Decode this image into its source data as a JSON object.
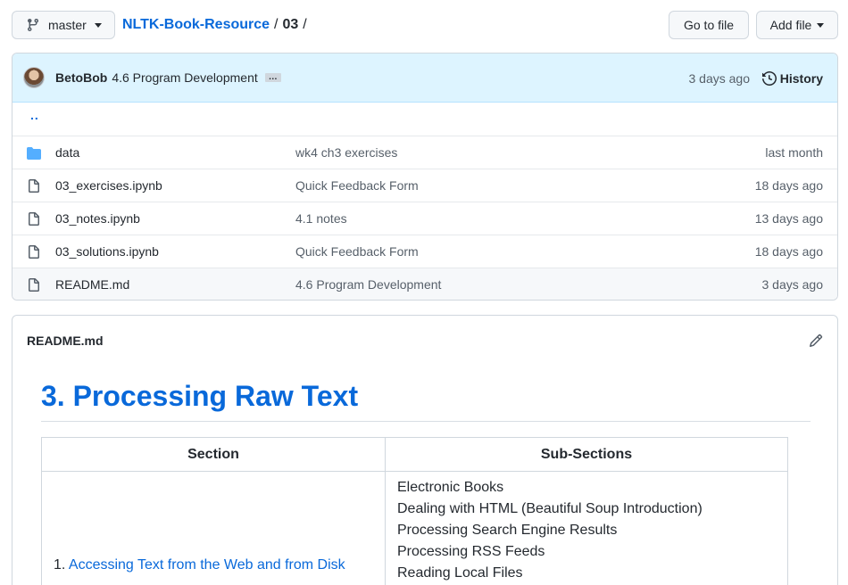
{
  "header": {
    "branch": "master",
    "repo": "NLTK-Book-Resource",
    "sep1": "/",
    "folder": "03",
    "sep2": "/",
    "go_to_file": "Go to file",
    "add_file": "Add file"
  },
  "commit": {
    "author": "BetoBob",
    "message": "4.6 Program Development",
    "ellipsis": "…",
    "age": "3 days ago",
    "history": "History"
  },
  "files": {
    "parent": "..",
    "rows": [
      {
        "name": "data",
        "type": "folder",
        "message": "wk4 ch3 exercises",
        "age": "last month"
      },
      {
        "name": "03_exercises.ipynb",
        "type": "file",
        "message": "Quick Feedback Form",
        "age": "18 days ago"
      },
      {
        "name": "03_notes.ipynb",
        "type": "file",
        "message": "4.1 notes",
        "age": "13 days ago"
      },
      {
        "name": "03_solutions.ipynb",
        "type": "file",
        "message": "Quick Feedback Form",
        "age": "18 days ago"
      },
      {
        "name": "README.md",
        "type": "file",
        "message": "4.6 Program Development",
        "age": "3 days ago"
      }
    ]
  },
  "readme": {
    "filename": "README.md",
    "title": "3. Processing Raw Text",
    "table": {
      "headers": [
        "Section",
        "Sub-Sections"
      ],
      "rows": [
        {
          "number": "1.",
          "section": "Accessing Text from the Web and from Disk",
          "subsections": [
            "Electronic Books",
            "Dealing with HTML (Beautiful Soup Introduction)",
            "Processing Search Engine Results",
            "Processing RSS Feeds",
            "Reading Local Files"
          ]
        }
      ]
    }
  },
  "colors": {
    "link": "#0969da",
    "commit_bg": "#ddf4ff",
    "folder_icon": "#54aeff",
    "muted": "#57606a"
  }
}
